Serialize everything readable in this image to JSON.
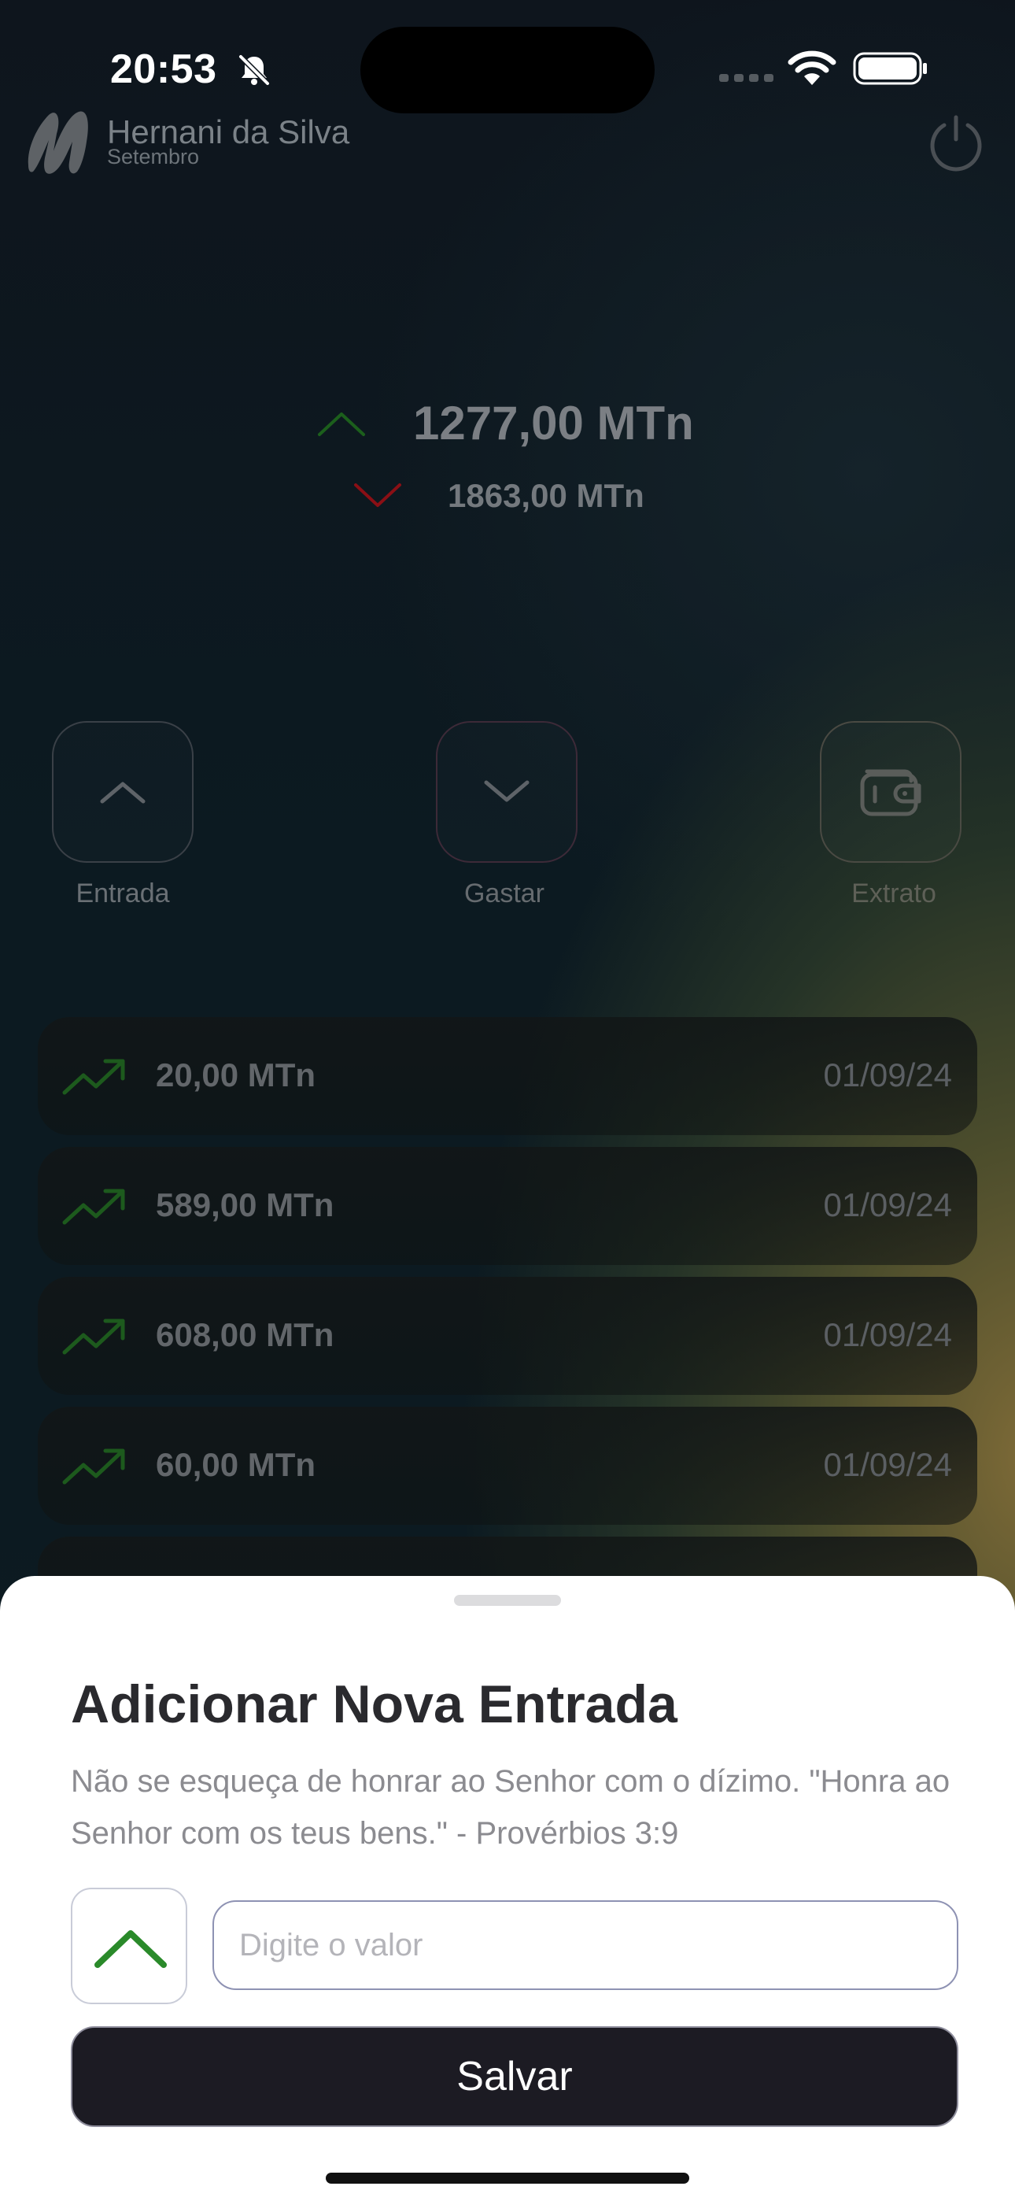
{
  "status_bar": {
    "time": "20:53"
  },
  "header": {
    "user_name": "Hernani da Silva",
    "month": "Setembro"
  },
  "totals": {
    "income": "1277,00 MTn",
    "expense": "1863,00 MTn"
  },
  "actions": [
    {
      "label": "Entrada",
      "icon": "chevron-up-icon"
    },
    {
      "label": "Gastar",
      "icon": "chevron-down-icon"
    },
    {
      "label": "Extrato",
      "icon": "wallet-icon"
    }
  ],
  "transactions": [
    {
      "amount": "20,00 MTn",
      "date": "01/09/24"
    },
    {
      "amount": "589,00 MTn",
      "date": "01/09/24"
    },
    {
      "amount": "608,00 MTn",
      "date": "01/09/24"
    },
    {
      "amount": "60,00 MTn",
      "date": "01/09/24"
    }
  ],
  "sheet": {
    "title": "Adicionar Nova Entrada",
    "description": "Não se esqueça de honrar ao Senhor com o dízimo. \"Honra ao Senhor com os teus bens.\" - Provérbios 3:9",
    "input_placeholder": "Digite o valor",
    "input_value": "",
    "save_label": "Salvar"
  },
  "colors": {
    "income": "#2a8a2a",
    "expense": "#b0141b",
    "save_button": "#1c1b23"
  }
}
